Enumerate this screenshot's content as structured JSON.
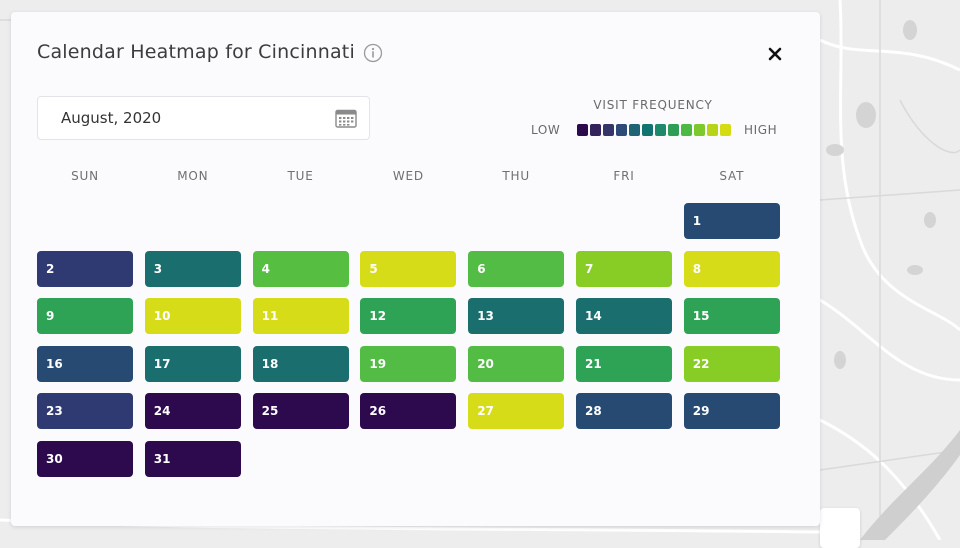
{
  "title": "Calendar Heatmap for Cincinnati",
  "icons": {
    "info": "info-icon",
    "close": "close-icon",
    "calendar": "calendar-icon"
  },
  "date_picker": {
    "value": "August, 2020"
  },
  "legend": {
    "title": "VISIT FREQUENCY",
    "low_label": "LOW",
    "high_label": "HIGH",
    "colors": [
      "#2d0a4e",
      "#33225b",
      "#36356a",
      "#2e4a77",
      "#1f6474",
      "#127470",
      "#1e8a6b",
      "#2d9e56",
      "#4bb943",
      "#7dc82b",
      "#b7d418",
      "#d6dc14"
    ]
  },
  "weekdays": [
    "SUN",
    "MON",
    "TUE",
    "WED",
    "THU",
    "FRI",
    "SAT"
  ],
  "calendar": {
    "first_weekday_index": 6,
    "days": [
      {
        "day": "1",
        "color": "#264a72"
      },
      {
        "day": "2",
        "color": "#2f3a72"
      },
      {
        "day": "3",
        "color": "#1b6e6e"
      },
      {
        "day": "4",
        "color": "#56bf42"
      },
      {
        "day": "5",
        "color": "#d7dc19"
      },
      {
        "day": "6",
        "color": "#52bc44"
      },
      {
        "day": "7",
        "color": "#88cd26"
      },
      {
        "day": "8",
        "color": "#d7dc19"
      },
      {
        "day": "9",
        "color": "#2ea356"
      },
      {
        "day": "10",
        "color": "#d7dc19"
      },
      {
        "day": "11",
        "color": "#d7dc19"
      },
      {
        "day": "12",
        "color": "#2ea356"
      },
      {
        "day": "13",
        "color": "#1b6e6e"
      },
      {
        "day": "14",
        "color": "#1b6e6e"
      },
      {
        "day": "15",
        "color": "#2ea356"
      },
      {
        "day": "16",
        "color": "#264a72"
      },
      {
        "day": "17",
        "color": "#1b6e6e"
      },
      {
        "day": "18",
        "color": "#1b6e6e"
      },
      {
        "day": "19",
        "color": "#52bc44"
      },
      {
        "day": "20",
        "color": "#52bc44"
      },
      {
        "day": "21",
        "color": "#2ea356"
      },
      {
        "day": "22",
        "color": "#88cd26"
      },
      {
        "day": "23",
        "color": "#2f3a72"
      },
      {
        "day": "24",
        "color": "#2d0a4e"
      },
      {
        "day": "25",
        "color": "#2d0a4e"
      },
      {
        "day": "26",
        "color": "#2d0a4e"
      },
      {
        "day": "27",
        "color": "#d7dc19"
      },
      {
        "day": "28",
        "color": "#264a72"
      },
      {
        "day": "29",
        "color": "#264a72"
      },
      {
        "day": "30",
        "color": "#2d0a4e"
      },
      {
        "day": "31",
        "color": "#2d0a4e"
      }
    ]
  }
}
